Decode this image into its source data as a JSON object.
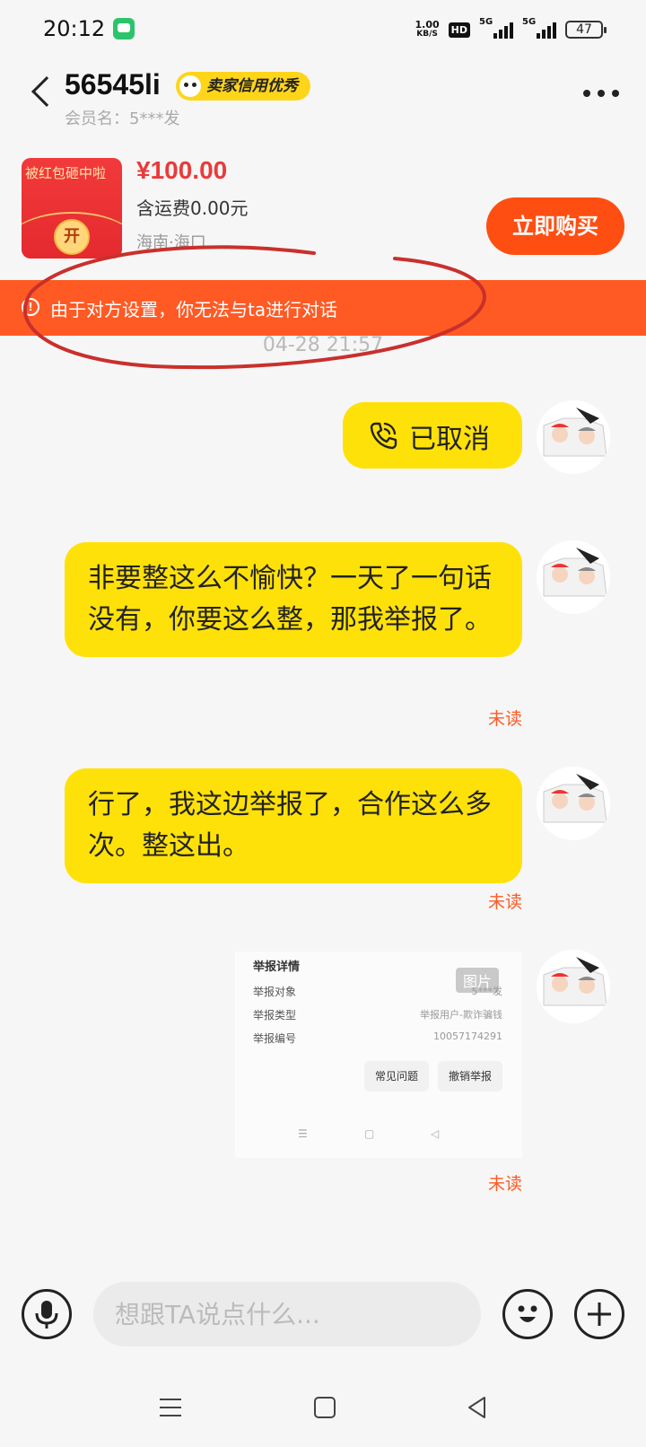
{
  "status_bar": {
    "time": "20:12",
    "net_speed_value": "1.00",
    "net_speed_unit": "KB/S",
    "hd_label": "HD",
    "signal1_label": "5G",
    "signal2_label": "5G",
    "battery": "47"
  },
  "header": {
    "title": "56545li",
    "seller_badge": "卖家信用优秀",
    "member_name": "会员名：5***发"
  },
  "product": {
    "thumb_text": "被红包砸中啦",
    "thumb_coin": "开",
    "price": "¥100.00",
    "shipping": "含运费0.00元",
    "location": "海南·海口",
    "buy_label": "立即购买"
  },
  "warning": {
    "text": "由于对方设置，你无法与ta进行对话"
  },
  "timestamp": "04-28 21:57",
  "messages": [
    {
      "type": "call",
      "text": "已取消"
    },
    {
      "type": "text",
      "text": "非要整这么不愉快？一天了一句话没有，你要这么整，那我举报了。",
      "status": "未读"
    },
    {
      "type": "text",
      "text": "行了，我这边举报了，合作这么多次。整这出。",
      "status": "未读"
    },
    {
      "type": "image",
      "status": "未读",
      "image": {
        "title": "举报详情",
        "badge": "图片",
        "rows": [
          {
            "label": "举报对象",
            "value": "5***发"
          },
          {
            "label": "举报类型",
            "value": "举报用户-欺诈骗钱"
          },
          {
            "label": "举报编号",
            "value": "10057174291"
          }
        ],
        "buttons": [
          "常见问题",
          "撤销举报"
        ]
      }
    }
  ],
  "input": {
    "placeholder": "想跟TA说点什么..."
  },
  "colors": {
    "accent_yellow": "#ffe10a",
    "warning_orange": "#ff5a24",
    "price_red": "#ea3a3a"
  }
}
